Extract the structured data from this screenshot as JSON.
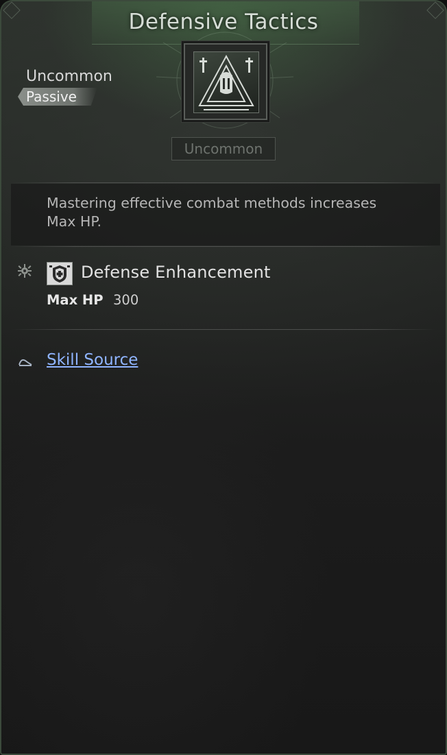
{
  "tooltip": {
    "title": "Defensive Tactics",
    "rarity": "Uncommon",
    "skill_type": "Passive",
    "icon": "skill-emblem-icon",
    "rarity_badge": "Uncommon",
    "description": "Mastering effective combat methods increases Max HP.",
    "effect": {
      "icon": "defense-enhancement-icon",
      "title": "Defense Enhancement",
      "stat_name": "Max HP",
      "stat_value": "300"
    },
    "source": {
      "icon": "source-icon",
      "label": "Skill Source"
    }
  },
  "colors": {
    "accent_green": "#5f8a5f",
    "link": "#8fb4ff",
    "rarity_dim": "#6e736e"
  }
}
